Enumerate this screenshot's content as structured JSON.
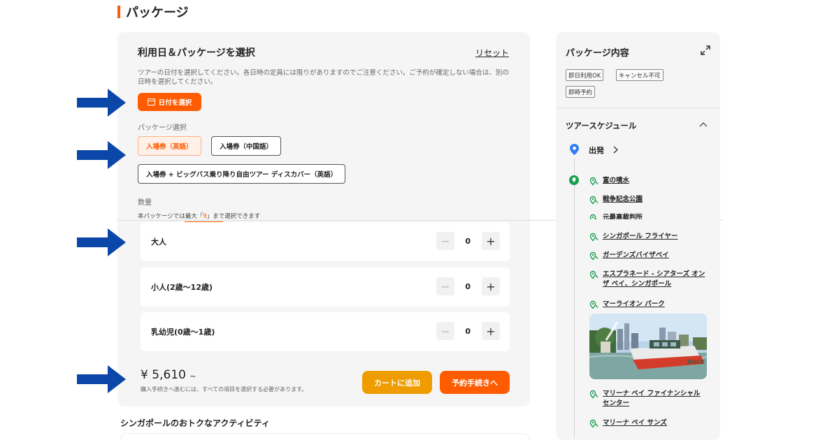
{
  "section": {
    "title": "パッケージ"
  },
  "selection": {
    "title": "利用日＆パッケージを選択",
    "reset": "リセット",
    "description": "ツアーの日付を選択してください。各日時の定員には限りがありますのでご注意ください。ご予約が確定しない場合は、別の日時を選択してください。",
    "date_button": "日付を選択",
    "package_label": "パッケージ選択",
    "packages": [
      {
        "label": "入場券（英語）",
        "selected": true
      },
      {
        "label": "入場券（中国語）",
        "selected": false
      },
      {
        "label": "入場券 + ビッグバス乗り降り自由ツアー ディスカバー（英語）",
        "selected": false
      }
    ],
    "quantity_label": "数量",
    "quantity_note_pre": "本パッケージでは最大「",
    "quantity_note_max": "9",
    "quantity_note_post": "」まで選択できます",
    "quantities": [
      {
        "label": "大人",
        "value": "0"
      },
      {
        "label": "小人(2歳〜12歳)",
        "value": "0"
      },
      {
        "label": "乳幼児(0歳〜1歳)",
        "value": "0"
      }
    ],
    "stepper": {
      "minus": "−",
      "plus": "+"
    },
    "price": "¥ 5,610",
    "price_suffix": "~",
    "price_note": "購入手続きへ進むには、すべての項目を選択する必要があります。",
    "cart_button": "カートに追加",
    "book_button": "予約手続きへ"
  },
  "bottom": {
    "title": "シンガポールのおトクなアクティビティ"
  },
  "details": {
    "title": "パッケージ内容",
    "tags": [
      "即日利用OK",
      "キャンセル不可",
      "即時予約"
    ],
    "schedule_title": "ツアースケジュール",
    "start": "出発",
    "stops": [
      "富の噴水",
      "戦争記念公園",
      "元最高裁判所",
      "シンガポール フライヤー",
      "ガーデンズバイザベイ",
      "エスプラネード - シアターズ オン ザ ベイ、シンガポール",
      "マーライオン パーク",
      "マリーナ ベイ ファイナンシャル センター",
      "マリーナ ベイ サンズ"
    ],
    "photo_boat_text": "DUCK"
  },
  "colors": {
    "accent": "#ff5b00",
    "cart": "#ee9c00",
    "arrow": "#0b47a8",
    "pin_green": "#1a9f4e",
    "pin_blue": "#2f7cf6"
  }
}
